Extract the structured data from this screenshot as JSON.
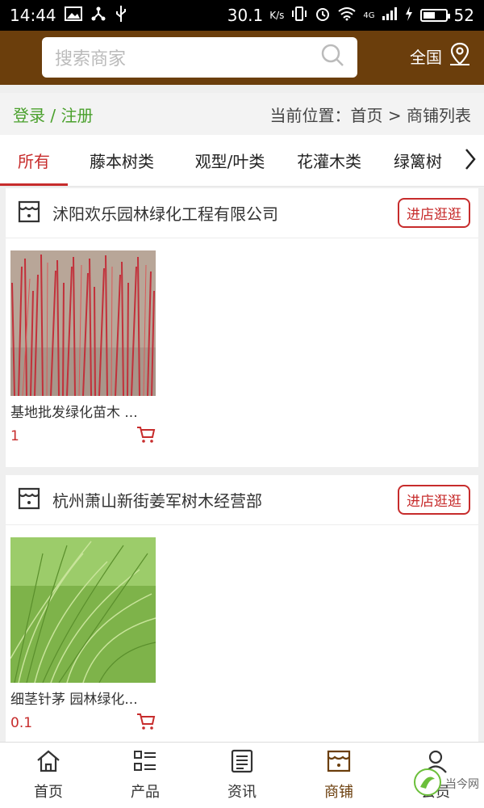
{
  "status": {
    "time": "14:44",
    "speed": "30.1",
    "speed_unit": "K/s",
    "network": "4G",
    "battery": "52"
  },
  "header": {
    "search_placeholder": "搜索商家",
    "region": "全国"
  },
  "breadcrumb": {
    "login": "登录 / 注册",
    "location": "当前位置：首页 > 商铺列表"
  },
  "tabs": [
    "所有",
    "藤本树类",
    "观型/叶类",
    "花灌木类",
    "绿篱树"
  ],
  "shops": [
    {
      "name": "沭阳欢乐园林绿化工程有限公司",
      "enter_label": "进店逛逛",
      "products": [
        {
          "title": "基地批发绿化苗木 ...",
          "price": "1"
        }
      ]
    },
    {
      "name": "杭州萧山新街姜军树木经营部",
      "enter_label": "进店逛逛",
      "products": [
        {
          "title": "细茎针茅 园林绿化...",
          "price": "0.1"
        }
      ]
    }
  ],
  "bottom_nav": [
    {
      "label": "首页",
      "icon": "home-icon"
    },
    {
      "label": "产品",
      "icon": "list-icon"
    },
    {
      "label": "资讯",
      "icon": "news-icon"
    },
    {
      "label": "商铺",
      "icon": "store-icon"
    },
    {
      "label": "会员",
      "icon": "user-icon"
    }
  ],
  "watermark": {
    "text": "当今网"
  },
  "colors": {
    "brand": "#6b3e0c",
    "accent": "#c72c2c",
    "login": "#4aa02c"
  }
}
